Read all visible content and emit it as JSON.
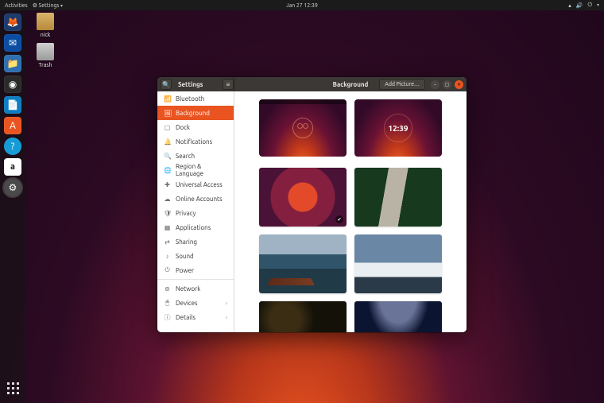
{
  "panel": {
    "activities": "Activities",
    "app_indicator": "Settings",
    "clock": "Jan 27  12:39"
  },
  "desktop": {
    "home_label": "nick",
    "trash_label": "Trash"
  },
  "dock": {
    "tooltips": [
      "Firefox",
      "Thunderbird",
      "Files",
      "Rhythmbox",
      "LibreOffice Writer",
      "Ubuntu Software",
      "Help",
      "Amazon",
      "Settings",
      "Show Applications"
    ]
  },
  "window": {
    "app_title": "Settings",
    "page_title": "Background",
    "add_picture": "Add Picture…",
    "lock_clock": "12:39",
    "sidebar": [
      {
        "icon": "📶",
        "label": "Bluetooth"
      },
      {
        "icon": "🖼",
        "label": "Background",
        "selected": true
      },
      {
        "icon": "▢",
        "label": "Dock"
      },
      {
        "icon": "🔔",
        "label": "Notifications"
      },
      {
        "icon": "🔍",
        "label": "Search"
      },
      {
        "icon": "🌐",
        "label": "Region & Language"
      },
      {
        "icon": "✚",
        "label": "Universal Access"
      },
      {
        "icon": "☁",
        "label": "Online Accounts"
      },
      {
        "icon": "🛡",
        "label": "Privacy"
      },
      {
        "icon": "▦",
        "label": "Applications"
      },
      {
        "icon": "⇄",
        "label": "Sharing"
      },
      {
        "icon": "♪",
        "label": "Sound"
      },
      {
        "icon": "⏻",
        "label": "Power"
      },
      {
        "icon": "⊚",
        "label": "Network"
      },
      {
        "icon": "🖱",
        "label": "Devices",
        "chevron": true
      },
      {
        "icon": "ⓘ",
        "label": "Details",
        "chevron": true
      }
    ]
  }
}
